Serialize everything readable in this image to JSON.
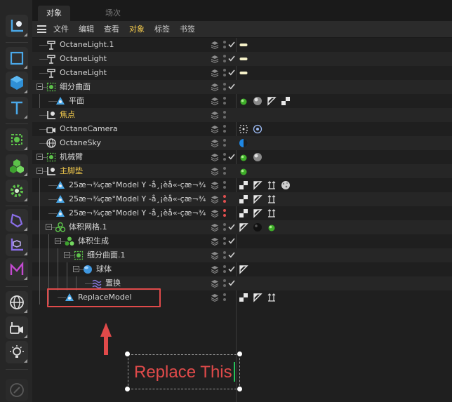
{
  "tabs": {
    "active": "对象",
    "inactive": "场次"
  },
  "menu": {
    "items": [
      "文件",
      "编辑",
      "查看",
      "对象",
      "标签",
      "书签"
    ],
    "highlighted": "对象"
  },
  "colors": {
    "highlight": "#f2c94c",
    "annotation": "#e04a4a",
    "caret": "#27c35a"
  },
  "toolbar_icons": [
    "coordinate-system-icon",
    "cube-outline-icon",
    "cube-solid-icon",
    "text-spline-icon",
    "subdivision-generator-icon",
    "cloner-icon",
    "gear-deformer-icon",
    "tag-icon",
    "axis-icon",
    "effector-icon",
    "globe-icon",
    "camera-icon",
    "light-bulb-icon",
    "pen-tool-icon"
  ],
  "objects": [
    {
      "name": "OctaneLight.1",
      "tags": [
        "light-tag"
      ]
    },
    {
      "name": "OctaneLight",
      "tags": [
        "light-tag"
      ]
    },
    {
      "name": "OctaneLight",
      "tags": [
        "light-tag"
      ]
    },
    {
      "name": "细分曲面",
      "tags": []
    },
    {
      "name": "平面",
      "tags": [
        "green-dot-tag",
        "material-ball-tag",
        "uv-tag",
        "checker-tag"
      ]
    },
    {
      "name": "焦点",
      "tags": []
    },
    {
      "name": "OctaneCamera",
      "tags": [
        "target-tag",
        "camera-tag"
      ]
    },
    {
      "name": "OctaneSky",
      "tags": [
        "sky-tag"
      ]
    },
    {
      "name": "机械臂",
      "tags": [
        "green-dot-tag",
        "material-ball-tag"
      ]
    },
    {
      "name": "主脚垫",
      "tags": [
        "green-dot-tag"
      ]
    },
    {
      "name": "25æ¬¾çæ°Model Y -å¸¡èå«-çæ¬¾.2",
      "tags": [
        "checker-tag",
        "uv-tag",
        "align-tag",
        "noise-ball-tag"
      ]
    },
    {
      "name": "25æ¬¾çæ°Model Y -å¸¡èå«-çæ¬¾.1",
      "tags": [
        "checker-tag",
        "uv-tag",
        "align-tag"
      ]
    },
    {
      "name": "25æ¬¾çæ°Model Y -å¸¡èå«-çæ¬¾",
      "tags": [
        "checker-tag",
        "uv-tag",
        "align-tag"
      ]
    },
    {
      "name": "体积网格.1",
      "tags": [
        "uv-tag",
        "dark-ball-tag",
        "green-dot-tag"
      ]
    },
    {
      "name": "体积生成",
      "tags": []
    },
    {
      "name": "细分曲面.1",
      "tags": []
    },
    {
      "name": "球体",
      "tags": [
        "uv-tag"
      ]
    },
    {
      "name": "置换",
      "tags": []
    },
    {
      "name": "ReplaceModel",
      "tags": [
        "checker-tag",
        "uv-tag",
        "align-tag"
      ]
    }
  ],
  "annotation": {
    "text": "Replace This"
  }
}
